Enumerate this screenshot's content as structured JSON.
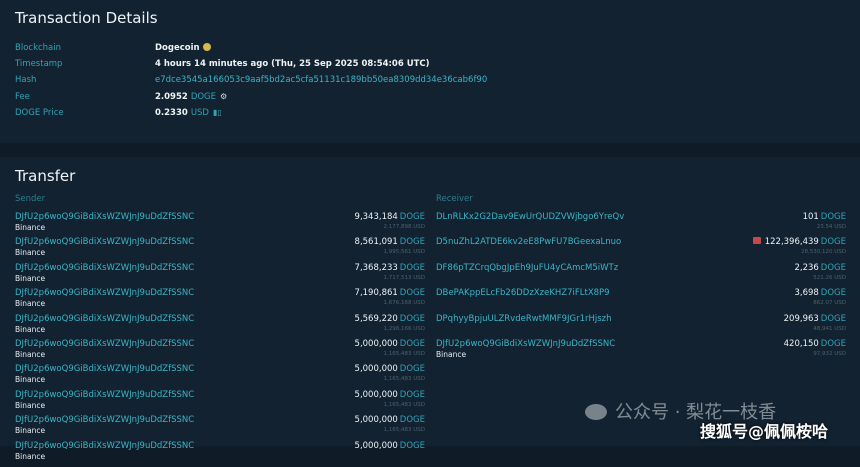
{
  "details": {
    "title": "Transaction Details",
    "blockchain": {
      "label": "Blockchain",
      "value": "Dogecoin"
    },
    "timestamp": {
      "label": "Timestamp",
      "value": "4 hours 14 minutes ago (Thu, 25 Sep 2025 08:54:06 UTC)"
    },
    "hash": {
      "label": "Hash",
      "value": "e7dce3545a166053c9aaf5bd2ac5cfa51131c189bb50ea8309dd34e36cab6f90"
    },
    "fee": {
      "label": "Fee",
      "value": "2.0952",
      "unit": "DOGE"
    },
    "price": {
      "label": "DOGE Price",
      "value": "0.2330",
      "unit": "USD"
    }
  },
  "transfer": {
    "title": "Transfer",
    "sender_header": "Sender",
    "receiver_header": "Receiver",
    "senders": [
      {
        "address": "DJfU2p6woQ9GiBdiXsWZWJnJ9uDdZfSSNC",
        "tag": "Binance",
        "amount": "9,343,184",
        "unit": "DOGE",
        "usd": "2,177,898 USD"
      },
      {
        "address": "DJfU2p6woQ9GiBdiXsWZWJnJ9uDdZfSSNC",
        "tag": "Binance",
        "amount": "8,561,091",
        "unit": "DOGE",
        "usd": "1,995,561 USD"
      },
      {
        "address": "DJfU2p6woQ9GiBdiXsWZWJnJ9uDdZfSSNC",
        "tag": "Binance",
        "amount": "7,368,233",
        "unit": "DOGE",
        "usd": "1,717,513 USD"
      },
      {
        "address": "DJfU2p6woQ9GiBdiXsWZWJnJ9uDdZfSSNC",
        "tag": "Binance",
        "amount": "7,190,861",
        "unit": "DOGE",
        "usd": "1,676,168 USD"
      },
      {
        "address": "DJfU2p6woQ9GiBdiXsWZWJnJ9uDdZfSSNC",
        "tag": "Binance",
        "amount": "5,569,220",
        "unit": "DOGE",
        "usd": "1,298,166 USD"
      },
      {
        "address": "DJfU2p6woQ9GiBdiXsWZWJnJ9uDdZfSSNC",
        "tag": "Binance",
        "amount": "5,000,000",
        "unit": "DOGE",
        "usd": "1,165,483 USD"
      },
      {
        "address": "DJfU2p6woQ9GiBdiXsWZWJnJ9uDdZfSSNC",
        "tag": "Binance",
        "amount": "5,000,000",
        "unit": "DOGE",
        "usd": "1,165,483 USD"
      },
      {
        "address": "DJfU2p6woQ9GiBdiXsWZWJnJ9uDdZfSSNC",
        "tag": "Binance",
        "amount": "5,000,000",
        "unit": "DOGE",
        "usd": "1,165,483 USD"
      },
      {
        "address": "DJfU2p6woQ9GiBdiXsWZWJnJ9uDdZfSSNC",
        "tag": "Binance",
        "amount": "5,000,000",
        "unit": "DOGE",
        "usd": "1,165,483 USD"
      },
      {
        "address": "DJfU2p6woQ9GiBdiXsWZWJnJ9uDdZfSSNC",
        "tag": "Binance",
        "amount": "5,000,000",
        "unit": "DOGE",
        "usd": ""
      }
    ],
    "receivers": [
      {
        "address": "DLnRLKx2G2Dav9EwUrQUDZVWjbgo6YreQv",
        "tag": "",
        "amount": "101",
        "unit": "DOGE",
        "usd": "23.54 USD",
        "flag": false
      },
      {
        "address": "D5nuZhL2ATDE6kv2eE8PwFU7BGeexaLnuo",
        "tag": "",
        "amount": "122,396,439",
        "unit": "DOGE",
        "usd": "28,530,120 USD",
        "flag": true
      },
      {
        "address": "DF86pTZCrqQbgJpEh9JuFU4yCAmcM5iWTz",
        "tag": "",
        "amount": "2,236",
        "unit": "DOGE",
        "usd": "521.26 USD",
        "flag": false
      },
      {
        "address": "DBePAKppELcFb26DDzXzeKHZ7iFLtX8P9",
        "tag": "",
        "amount": "3,698",
        "unit": "DOGE",
        "usd": "862.07 USD",
        "flag": false
      },
      {
        "address": "DPqhyyBpjuULZRvdeRwtMMF9JGr1rHjszh",
        "tag": "",
        "amount": "209,963",
        "unit": "DOGE",
        "usd": "48,941 USD",
        "flag": false
      },
      {
        "address": "DJfU2p6woQ9GiBdiXsWZWJnJ9uDdZfSSNC",
        "tag": "Binance",
        "amount": "420,150",
        "unit": "DOGE",
        "usd": "97,932 USD",
        "flag": false
      }
    ]
  },
  "watermark": {
    "line1": "公众号 · 梨花一枝香",
    "line2": "搜狐号@佩佩桉哈"
  }
}
